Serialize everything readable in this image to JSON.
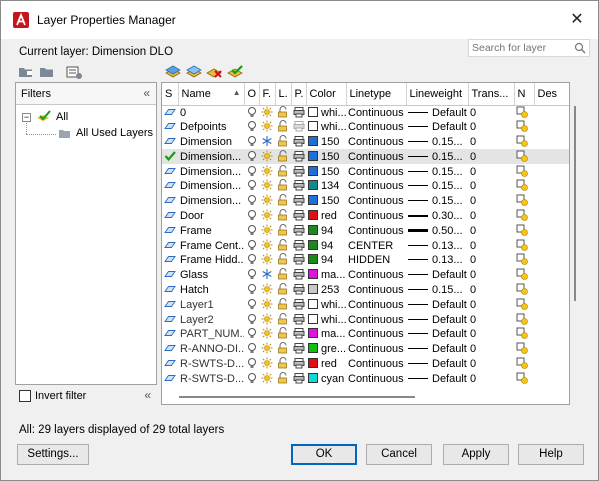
{
  "window": {
    "title": "Layer Properties Manager",
    "close_glyph": "✕"
  },
  "current_layer": "Current layer: Dimension DLO",
  "search": {
    "placeholder": "Search for layer"
  },
  "filters": {
    "header": "Filters",
    "collapse_glyph": "«",
    "tree": [
      {
        "label": "All"
      },
      {
        "label": "All Used Layers"
      }
    ],
    "invert_label": "Invert filter"
  },
  "grid": {
    "columns": [
      "S",
      "Name",
      "O",
      "F.",
      "L.",
      "P.",
      "Color",
      "Linetype",
      "Lineweight",
      "Trans...",
      "N",
      "Des"
    ],
    "rows": [
      {
        "name": "0",
        "color_name": "whi...",
        "color_hex": "#ffffff",
        "linetype": "Continuous",
        "lw": "Default",
        "lw_style": "thin",
        "trans": "0",
        "icon": "layer-icon",
        "freeze": "sun"
      },
      {
        "name": "Defpoints",
        "color_name": "whi...",
        "color_hex": "#ffffff",
        "linetype": "Continuous",
        "lw": "Default",
        "lw_style": "thin",
        "trans": "0",
        "icon": "layer-icon",
        "freeze": "sun",
        "noplot": true
      },
      {
        "name": "Dimension",
        "color_name": "150",
        "color_hex": "#1f6fd8",
        "linetype": "Continuous",
        "lw": "0.15...",
        "lw_style": "thin",
        "trans": "0",
        "icon": "layer-icon",
        "freeze": "snow"
      },
      {
        "name": "Dimension...",
        "color_name": "150",
        "color_hex": "#1f6fd8",
        "linetype": "Continuous",
        "lw": "0.15...",
        "lw_style": "thin",
        "trans": "0",
        "icon": "current-check-icon",
        "freeze": "sun",
        "selected": true
      },
      {
        "name": "Dimension...",
        "color_name": "150",
        "color_hex": "#1f6fd8",
        "linetype": "Continuous",
        "lw": "0.15...",
        "lw_style": "thin",
        "trans": "0",
        "icon": "layer-icon",
        "freeze": "sun"
      },
      {
        "name": "Dimension...",
        "color_name": "134",
        "color_hex": "#138a8a",
        "linetype": "Continuous",
        "lw": "0.15...",
        "lw_style": "thin",
        "trans": "0",
        "icon": "layer-icon",
        "freeze": "sun"
      },
      {
        "name": "Dimension...",
        "color_name": "150",
        "color_hex": "#1f6fd8",
        "linetype": "Continuous",
        "lw": "0.15...",
        "lw_style": "thin",
        "trans": "0",
        "icon": "layer-icon",
        "freeze": "sun"
      },
      {
        "name": "Door",
        "color_name": "red",
        "color_hex": "#e01010",
        "linetype": "Continuous",
        "lw": "0.30...",
        "lw_style": "thick",
        "trans": "0",
        "icon": "layer-icon",
        "freeze": "sun"
      },
      {
        "name": "Frame",
        "color_name": "94",
        "color_hex": "#1a8a1a",
        "linetype": "Continuous",
        "lw": "0.50...",
        "lw_style": "thick",
        "trans": "0",
        "icon": "layer-icon",
        "freeze": "sun"
      },
      {
        "name": "Frame Cent...",
        "color_name": "94",
        "color_hex": "#1a8a1a",
        "linetype": "CENTER",
        "lw": "0.13...",
        "lw_style": "thin",
        "trans": "0",
        "icon": "layer-icon",
        "freeze": "sun"
      },
      {
        "name": "Frame Hidd...",
        "color_name": "94",
        "color_hex": "#1a8a1a",
        "linetype": "HIDDEN",
        "lw": "0.13...",
        "lw_style": "thin",
        "trans": "0",
        "icon": "layer-icon",
        "freeze": "sun"
      },
      {
        "name": "Glass",
        "color_name": "ma...",
        "color_hex": "#e010e0",
        "linetype": "Continuous",
        "lw": "Default",
        "lw_style": "thin",
        "trans": "0",
        "icon": "layer-icon",
        "freeze": "snow"
      },
      {
        "name": "Hatch",
        "color_name": "253",
        "color_hex": "#c8c8c8",
        "linetype": "Continuous",
        "lw": "0.15...",
        "lw_style": "thin",
        "trans": "0",
        "icon": "layer-icon",
        "freeze": "sun"
      },
      {
        "name": "Layer1",
        "color_name": "whi...",
        "color_hex": "#ffffff",
        "linetype": "Continuous",
        "lw": "Default",
        "lw_style": "thin",
        "trans": "0",
        "icon": "layer-icon",
        "freeze": "sun",
        "faded": true
      },
      {
        "name": "Layer2",
        "color_name": "whi...",
        "color_hex": "#ffffff",
        "linetype": "Continuous",
        "lw": "Default",
        "lw_style": "thin",
        "trans": "0",
        "icon": "layer-icon",
        "freeze": "sun",
        "faded": true
      },
      {
        "name": "PART_NUM...",
        "color_name": "ma...",
        "color_hex": "#e010e0",
        "linetype": "Continuous",
        "lw": "Default",
        "lw_style": "thin",
        "trans": "0",
        "icon": "layer-icon",
        "freeze": "sun",
        "faded": true
      },
      {
        "name": "R-ANNO-DI...",
        "color_name": "gre...",
        "color_hex": "#10c010",
        "linetype": "Continuous",
        "lw": "Default",
        "lw_style": "thin",
        "trans": "0",
        "icon": "layer-icon",
        "freeze": "sun",
        "faded": true
      },
      {
        "name": "R-SWTS-D...",
        "color_name": "red",
        "color_hex": "#e01010",
        "linetype": "Continuous",
        "lw": "Default",
        "lw_style": "thin",
        "trans": "0",
        "icon": "layer-icon",
        "freeze": "sun",
        "faded": true
      },
      {
        "name": "R-SWTS-D...",
        "color_name": "cyan",
        "color_hex": "#10d8d8",
        "linetype": "Continuous",
        "lw": "Default",
        "lw_style": "thin",
        "trans": "0",
        "icon": "layer-icon",
        "freeze": "sun",
        "faded": true
      }
    ]
  },
  "status": "All: 29 layers displayed of 29 total layers",
  "buttons": {
    "settings": "Settings...",
    "ok": "OK",
    "cancel": "Cancel",
    "apply": "Apply",
    "help": "Help"
  },
  "colors": {
    "accent": "#0067c0",
    "selected_row": "#e4e4e4",
    "folder_yellow": "#e8b93a",
    "layer_blue": "#2b6cc0"
  }
}
